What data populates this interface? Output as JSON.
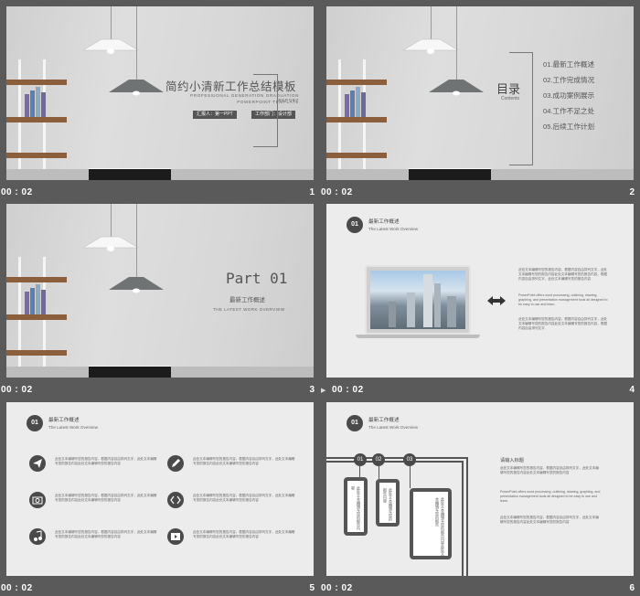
{
  "slides": [
    {
      "time": "00 : 02",
      "number": "1",
      "title": "简约小清新工作总结模板",
      "subtitle_line1": "PROFESSIONAL  GENERATION  GRADUATION  REPORT",
      "subtitle_line2": "POWERPOINT  TEMPLATE",
      "reporter": "汇报人：第一PPT",
      "department": "工作部门：设计部"
    },
    {
      "time": "00 : 02",
      "number": "2",
      "toc_title": "目录",
      "toc_sub": "Contents",
      "toc_items": [
        "01.最新工作概述",
        "02.工作完成情况",
        "03.成功案例展示",
        "04.工作不足之处",
        "05.后续工作计划"
      ]
    },
    {
      "time": "00 : 02",
      "number": "3",
      "part_title": "Part 01",
      "part_cn": "最新工作概述",
      "part_en": "THE LATEST WORK OVERVIEW"
    },
    {
      "time": "00 : 02",
      "number": "4",
      "badge": "01",
      "hdr_cn": "最新工作概述",
      "hdr_en": "The Latest Work Overview",
      "para1": "此处文本编辑写您的报告内容，根据内容自由排列文字，此处文本编辑写您的报告内容此处文本编辑写您的报告内容，根据内容自由排列文字，此处文本编辑写您的报告内容",
      "para2": "PowerPoint offers word processing, outlining, drawing, graphing, and presentation management tools all designed to be easy to use and learn.",
      "para3": "此处文本编辑写您的报告内容，根据内容自由排列文字，此处文本编辑写您的报告内容此处文本编辑写您的报告内容，根据内容自由排列文字"
    },
    {
      "time": "00 : 02",
      "number": "5",
      "badge": "01",
      "hdr_cn": "最新工作概述",
      "hdr_en": "The Latest Work Overview",
      "item_text": "此处文本编辑写您的报告内容，根据内容自由排列文字，此处文本编辑写您的报告内容此处文本编辑写您的报告内容"
    },
    {
      "time": "00 : 02",
      "number": "6",
      "badge": "01",
      "hdr_cn": "最新工作概述",
      "hdr_en": "The Latest Work Overview",
      "steps": [
        "01",
        "02",
        "03"
      ],
      "phone1": "此处文本编辑写您的报告内容",
      "phone2": "此处文本编辑写您的报告内容",
      "phone3": "此处文本编辑写您的报告内容此处文本编辑写您的报告",
      "side_title": "请输入标题",
      "side_para1": "此处文本编辑写您的报告内容，根据内容自由排列文字，此处文本编辑写您的报告内容此处文本编辑写您的报告内容",
      "side_para2": "PowerPoint offers word processing, outlining, drawing, graphing, and presentation management tools all designed to be easy to use and learn.",
      "side_para3": "此处文本编辑写您的报告内容，根据内容自由排列文字，此处文本编辑写您的报告内容此处文本编辑写您的报告内容"
    }
  ],
  "colors": {
    "background": "#5a5a5a",
    "slide": "#ececec",
    "accent": "#4a4a4a",
    "wood": "#8b5e3c"
  }
}
